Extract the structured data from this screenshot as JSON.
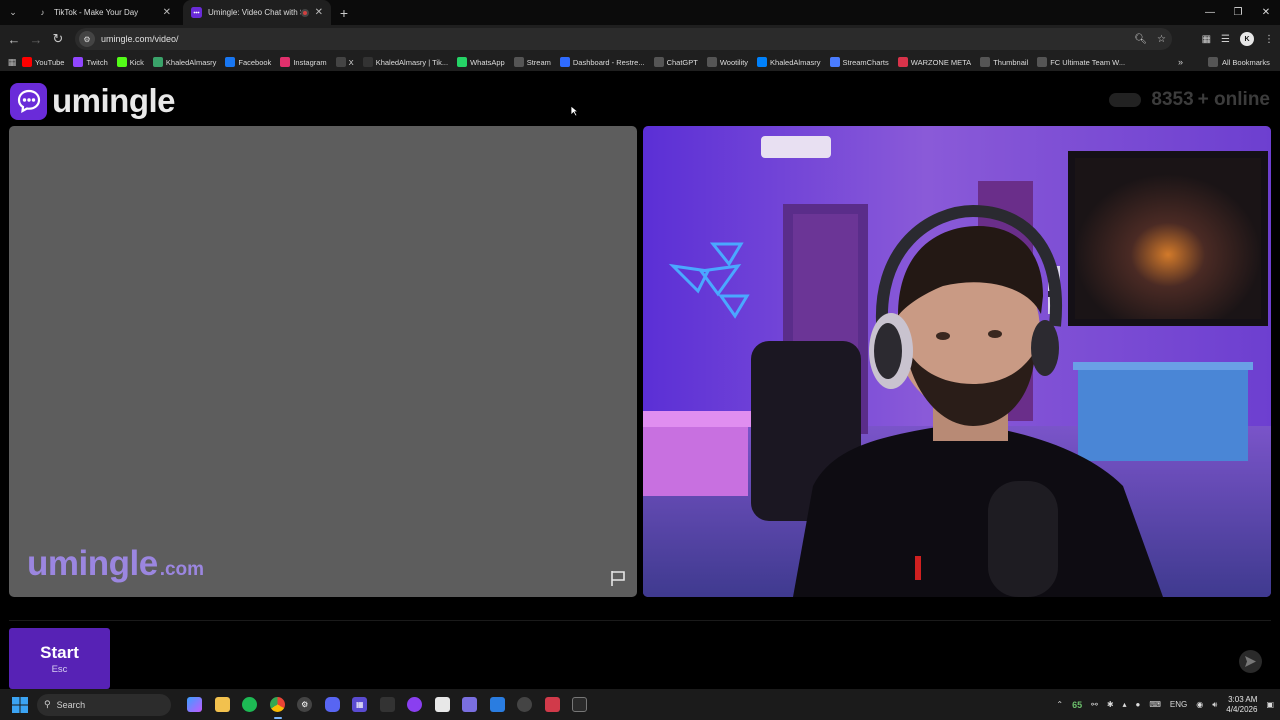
{
  "browser": {
    "tabs": [
      {
        "title": "TikTok - Make Your Day",
        "active": false,
        "icon": "tiktok-icon"
      },
      {
        "title": "Umingle: Video Chat with S",
        "active": true,
        "icon": "umingle-icon"
      }
    ],
    "url": "umingle.com/video/",
    "bookmarks": [
      {
        "label": "YouTube",
        "icon": "youtube-icon",
        "color": "#ff0000"
      },
      {
        "label": "Twitch",
        "icon": "twitch-icon",
        "color": "#9146ff"
      },
      {
        "label": "Kick",
        "icon": "kick-icon",
        "color": "#53fc18"
      },
      {
        "label": "KhaledAlmasry",
        "icon": "chatgpt-style-icon",
        "color": "#3aa36a"
      },
      {
        "label": "Facebook",
        "icon": "facebook-icon",
        "color": "#1877f2"
      },
      {
        "label": "Instagram",
        "icon": "instagram-icon",
        "color": "#e1306c"
      },
      {
        "label": "X",
        "icon": "x-icon",
        "color": "#444444"
      },
      {
        "label": "KhaledAlmasry | Tik...",
        "icon": "tiktok-icon",
        "color": "#333333"
      },
      {
        "label": "WhatsApp",
        "icon": "whatsapp-icon",
        "color": "#25d366"
      },
      {
        "label": "Stream",
        "icon": "folder-icon",
        "color": "#555555"
      },
      {
        "label": "Dashboard - Restre...",
        "icon": "restream-icon",
        "color": "#2f6bff"
      },
      {
        "label": "ChatGPT",
        "icon": "chatgpt-icon",
        "color": "#555555"
      },
      {
        "label": "Wootility",
        "icon": "wooting-icon",
        "color": "#555555"
      },
      {
        "label": "KhaledAlmasry",
        "icon": "meta-icon",
        "color": "#0081fb"
      },
      {
        "label": "StreamCharts",
        "icon": "streamcharts-icon",
        "color": "#4a7cff"
      },
      {
        "label": "WARZONE META",
        "icon": "warzone-icon",
        "color": "#d8334a"
      },
      {
        "label": "Thumbnail",
        "icon": "folder-icon",
        "color": "#555555"
      },
      {
        "label": "FC Ultimate Team W...",
        "icon": "ea-icon",
        "color": "#555555"
      }
    ],
    "all_bookmarks": "All Bookmarks"
  },
  "site": {
    "logo_text": "umingle",
    "online_count": "8353",
    "online_label": "+ online",
    "watermark_main": "umingle",
    "watermark_tld": ".com",
    "start_label": "Start",
    "start_key": "Esc"
  },
  "taskbar": {
    "search_placeholder": "Search",
    "tray_number": "65",
    "language": "ENG",
    "time": "3:03 AM",
    "date": "4/4/2026"
  },
  "colors": {
    "brand_purple": "#5722b5",
    "logo_badge": "#6a2bd9",
    "watermark": "#9b86e0"
  }
}
